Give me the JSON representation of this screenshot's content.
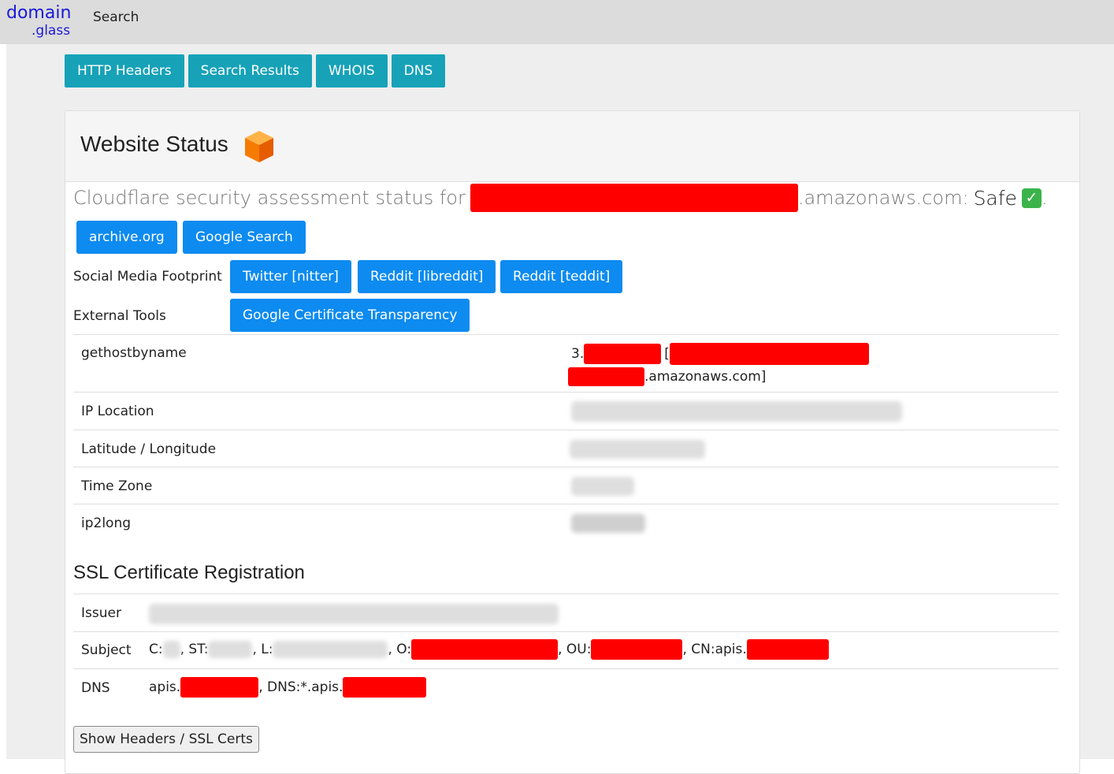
{
  "brand": {
    "line1": "domain",
    "line2": ".glass"
  },
  "nav": {
    "search": "Search"
  },
  "tabs": [
    "HTTP Headers",
    "Search Results",
    "WHOIS",
    "DNS"
  ],
  "card": {
    "title": "Website Status",
    "title_icon": "orange-cube-icon"
  },
  "status": {
    "prefix": "Cloudflare security assessment status for",
    "suffix": ".amazonaws.com:",
    "result": "Safe",
    "result_icon": "green-check-icon",
    "end": "."
  },
  "quick_buttons": [
    "archive.org",
    "Google Search"
  ],
  "social": {
    "label": "Social Media Footprint",
    "buttons": [
      "Twitter [nitter]",
      "Reddit [libreddit]",
      "Reddit [teddit]"
    ]
  },
  "external": {
    "label": "External Tools",
    "buttons": [
      "Google Certificate Transparency"
    ]
  },
  "info": {
    "gethostbyname": {
      "key": "gethostbyname",
      "prefix": "3.",
      "bracket": "[",
      "suffix": ".amazonaws.com]"
    },
    "ip_location": {
      "key": "IP Location"
    },
    "latlong": {
      "key": "Latitude / Longitude"
    },
    "timezone": {
      "key": "Time Zone"
    },
    "ip2long": {
      "key": "ip2long"
    }
  },
  "ssl": {
    "title": "SSL Certificate Registration",
    "issuer_key": "Issuer",
    "subject_key": "Subject",
    "subject_parts": {
      "c": "C:",
      "st": ", ST:",
      "l": ", L:",
      "o": ", O:",
      "ou": ", OU:",
      "cn": ", CN:apis."
    },
    "dns_key": "DNS",
    "dns_parts": {
      "a": "apis.",
      "b": ", DNS:*.apis."
    }
  },
  "show_button": "Show Headers / SSL Certs",
  "colors": {
    "tab": "#17a2b8",
    "button": "#0d8bf0",
    "redaction": "#ff0000",
    "brand": "#1a1ad6"
  }
}
